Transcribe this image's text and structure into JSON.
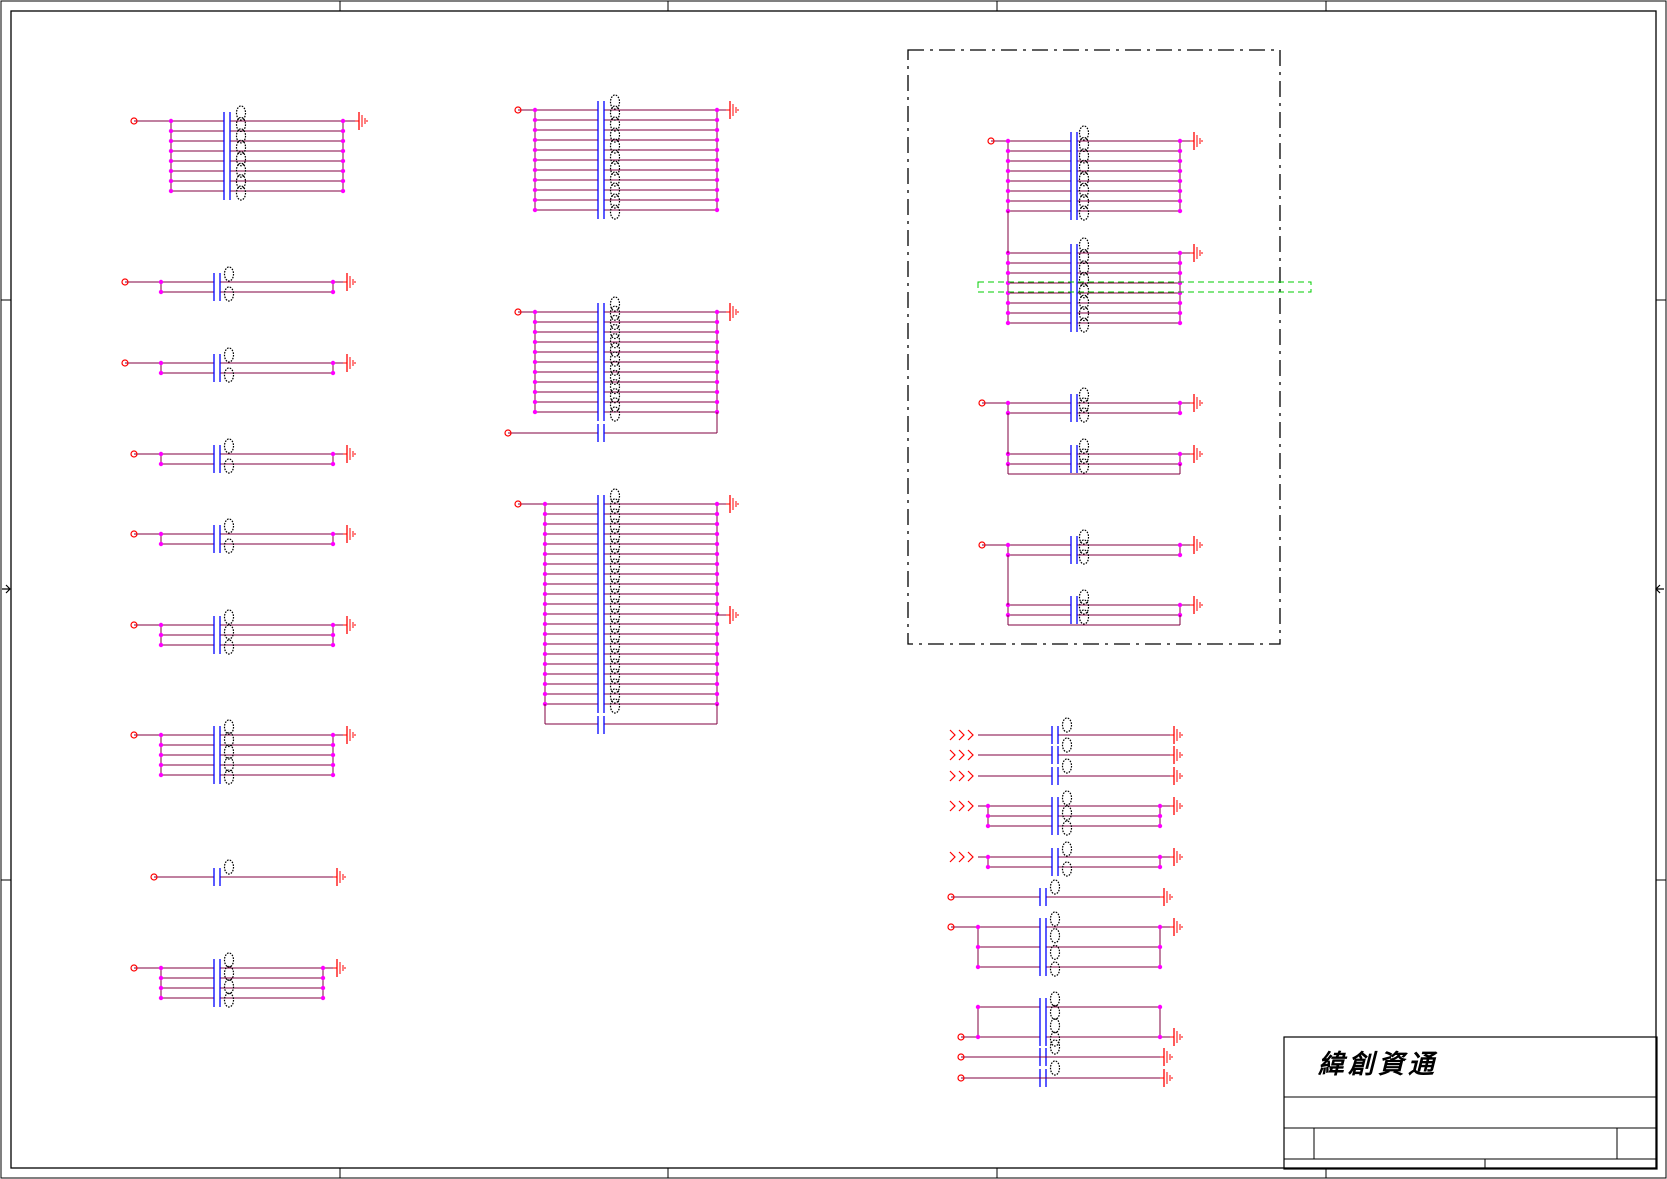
{
  "title_block": {
    "company": "緯創資通"
  },
  "colors": {
    "wire": "#800040",
    "junction": "#ff00ff",
    "capacitor": "#0000ff",
    "net": "#ff0000",
    "ground": "#ff0000",
    "label_blob": "#000000",
    "border": "#000000",
    "highlight": "#00cc00"
  },
  "icons": {
    "ground": "ground-icon",
    "net_port": "net-port-icon",
    "offpage": "offpage-connector-icon",
    "capacitor": "capacitor-icon"
  }
}
